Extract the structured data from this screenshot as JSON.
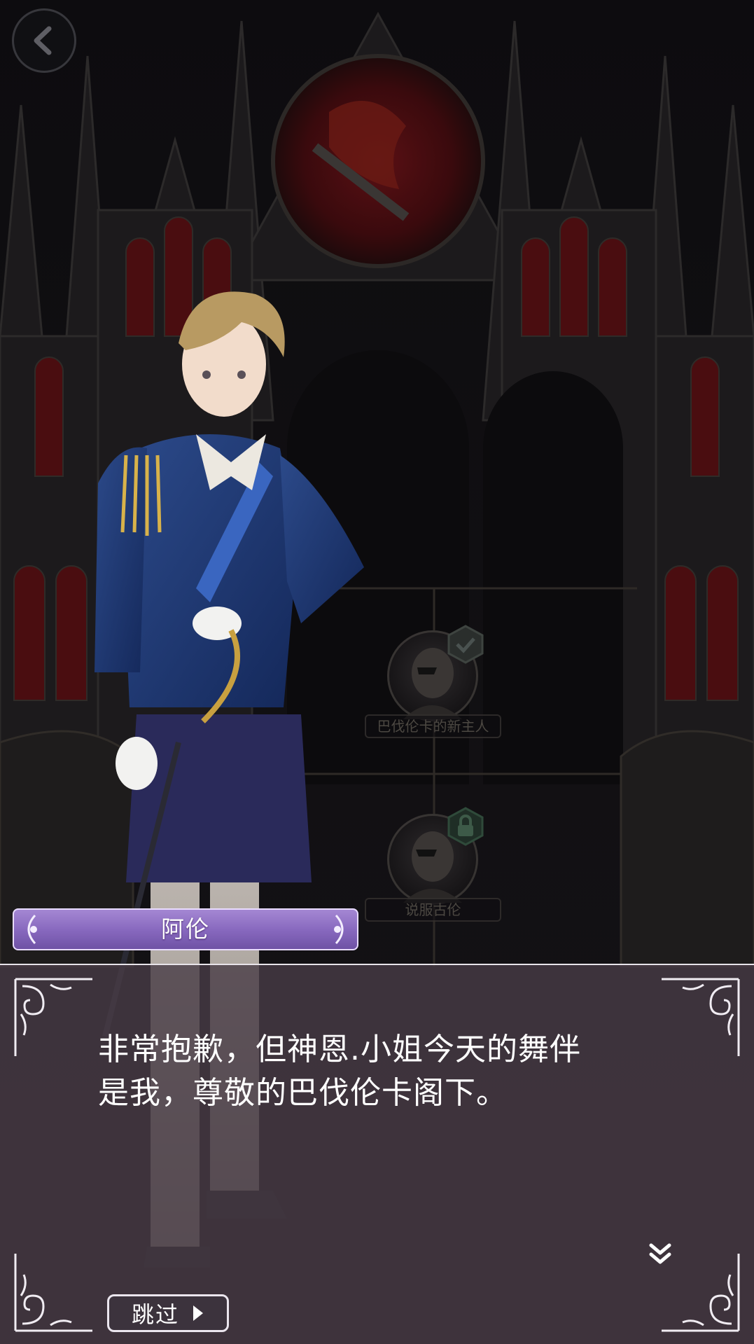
{
  "speaker": {
    "name": "阿伦"
  },
  "dialog": {
    "text": "非常抱歉，但神恩.小姐今天的舞伴\n是我，尊敬的巴伐伦卡阁下。"
  },
  "story_nodes": [
    {
      "label": "巴伐伦卡的新主人",
      "status": "completed",
      "badge_icon": "check-icon"
    },
    {
      "label": "说服古伦",
      "status": "locked",
      "badge_icon": "lock-icon"
    }
  ],
  "controls": {
    "skip_label": "跳过",
    "back_icon": "back-arrow-icon",
    "next_icon": "double-chevron-down-icon"
  },
  "colors": {
    "name_plate": "#8a6cc0",
    "dialog_bg": "#4a3c48",
    "frame_accent": "#e8e4ea",
    "glass_red": "#7a1418"
  }
}
